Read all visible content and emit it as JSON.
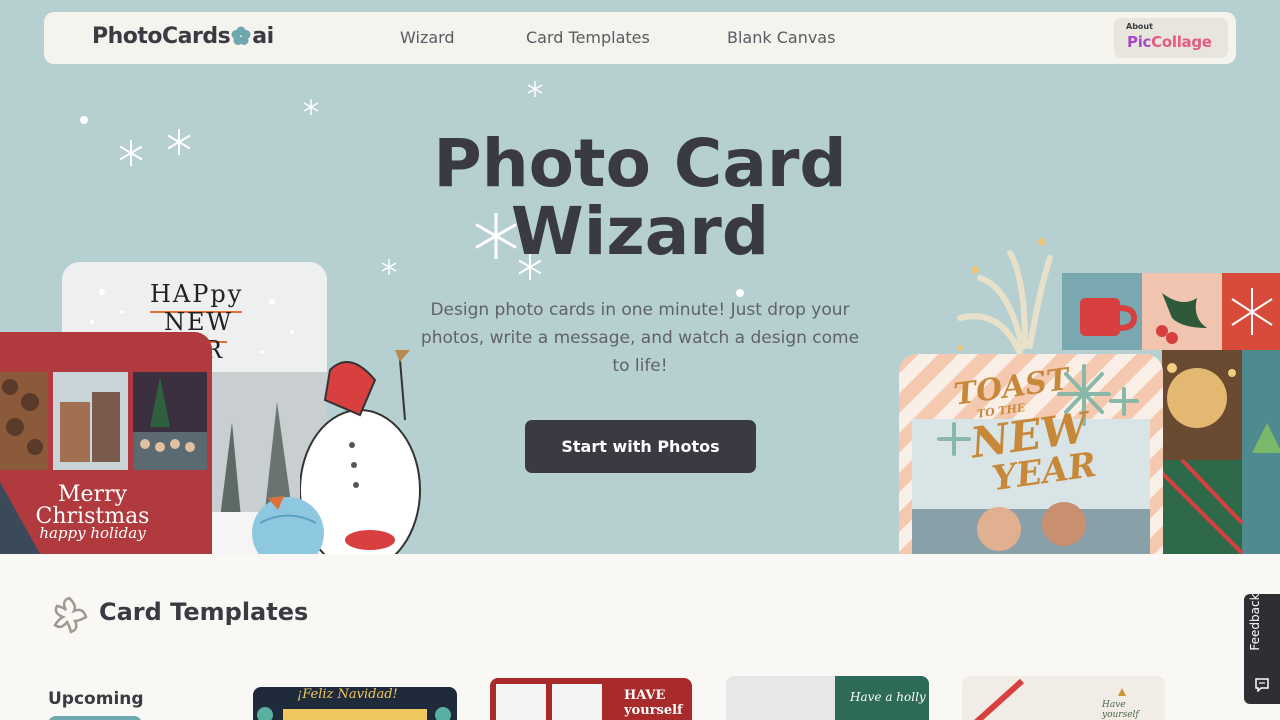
{
  "nav": {
    "logo_text": "PhotoCards",
    "logo_suffix": "ai",
    "links": [
      "Wizard",
      "Card Templates",
      "Blank Canvas"
    ],
    "about_small": "About",
    "about_brand_a": "Pic",
    "about_brand_b": "Collage"
  },
  "hero": {
    "title_line1": "Photo Card",
    "title_line2": "Wizard",
    "subtitle": "Design photo cards in one minute! Just drop your photos, write a message, and watch a design come to life!",
    "cta_label": "Start with Photos",
    "left_card_top": [
      "HAPpy",
      "NEW",
      "R"
    ],
    "left_card_title": "Merry Christmas",
    "left_card_subtitle": "happy holiday",
    "right_card_text": [
      "TOAST",
      "TO THE",
      "NEW",
      "YEAR"
    ]
  },
  "templates": {
    "section_title": "Card Templates",
    "upcoming_label": "Upcoming",
    "items": [
      {
        "label": "¡Feliz Navidad!"
      },
      {
        "label": "HAVE yourself"
      },
      {
        "label": "Have a holly"
      },
      {
        "label": "Have yourself"
      }
    ]
  },
  "feedback": {
    "label": "Feedback"
  },
  "colors": {
    "hero_bg": "#b6cfd1",
    "dark": "#3a3a42",
    "accent_teal": "#6ea7ad",
    "xmas_red": "#b13a3e"
  }
}
